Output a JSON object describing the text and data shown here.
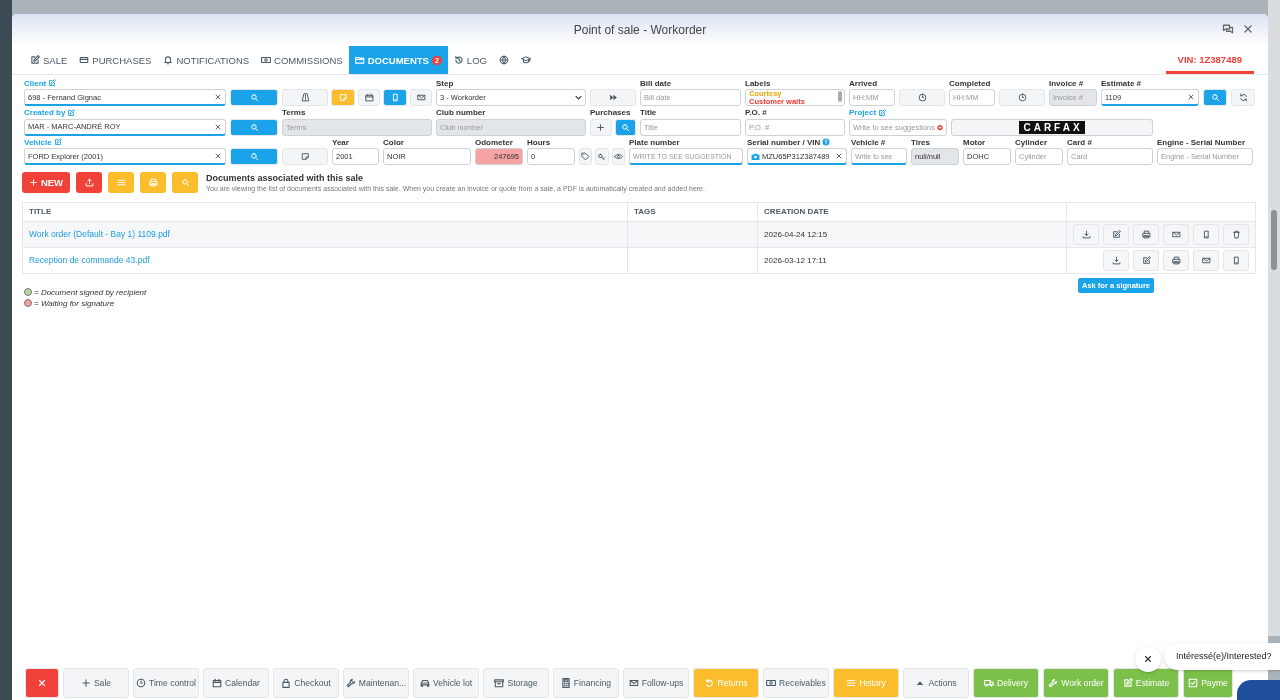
{
  "window": {
    "title": "Point of sale - Workorder"
  },
  "tabs": [
    {
      "label": "SALE",
      "selected": false
    },
    {
      "label": "PURCHASES",
      "selected": false
    },
    {
      "label": "NOTIFICATIONS",
      "selected": false
    },
    {
      "label": "COMMISSIONS",
      "selected": false
    },
    {
      "label": "DOCUMENTS",
      "badge": "2",
      "selected": true
    },
    {
      "label": "LOG",
      "selected": false
    },
    {
      "selected": false
    },
    {
      "selected": false
    }
  ],
  "vin": "VIN: 1Z387489",
  "form_rows": [
    [
      {
        "kind": "field",
        "label": "Client",
        "linked": true,
        "value": "698 - Fernand Gignac",
        "clearable": true
      },
      {
        "kind": "button",
        "color": "#1aa3e8"
      },
      {
        "kind": "buttons",
        "items": [
          {
            "color": "#f3f5f6"
          },
          {
            "color": "#fbbd2c"
          },
          {
            "color": "#f3f5f6"
          },
          {
            "color": "#1aa3e8"
          },
          {
            "color": "#f3f5f6"
          }
        ]
      },
      {
        "kind": "select",
        "label": "Step",
        "linked": false,
        "value": "3 - Workorder"
      },
      {
        "kind": "button",
        "color": "#f3f5f6"
      },
      {
        "kind": "field",
        "label": "Bill date",
        "linked": false,
        "placeholder": "Bill date"
      },
      {
        "kind": "labels",
        "label": "Labels",
        "linked": false,
        "items": [
          {
            "text": "Courtesy",
            "color": "#e6a700"
          },
          {
            "text": "Customer waits",
            "color": "#e53935"
          }
        ]
      },
      {
        "kind": "field",
        "label": "Arrived",
        "linked": false,
        "placeholder": "HH:MM"
      },
      {
        "kind": "button",
        "color": "#f3f5f6"
      },
      {
        "kind": "field",
        "label": "Completed",
        "linked": false,
        "placeholder": "HH:MM"
      },
      {
        "kind": "button",
        "color": "#f3f5f6"
      },
      {
        "kind": "field",
        "label": "Invoice #",
        "linked": false,
        "placeholder": "Invoice #",
        "disabled": true
      },
      {
        "kind": "field",
        "label": "Estimate #",
        "linked": false,
        "value": "1109",
        "clearable": true
      },
      {
        "kind": "button",
        "color": "#1aa3e8"
      },
      {
        "kind": "button",
        "color": "#f3f5f6"
      }
    ],
    [
      {
        "kind": "field",
        "label": "Created by",
        "linked": true,
        "value": "MAR - MARC-ANDRÉ ROY",
        "clearable": true
      },
      {
        "kind": "button",
        "color": "#1aa3e8"
      },
      {
        "kind": "field",
        "label": "Terms",
        "linked": false,
        "placeholder": "Terms",
        "disabled": true
      },
      {
        "kind": "field",
        "label": "Club number",
        "linked": false,
        "placeholder": "Club number",
        "disabled": true
      },
      {
        "kind": "buttons",
        "label": "Purchases",
        "linked": false,
        "items": [
          {
            "color": "#f3f5f6"
          },
          {
            "color": "#1aa3e8"
          }
        ]
      },
      {
        "kind": "field",
        "label": "Title",
        "linked": false,
        "placeholder": "Title"
      },
      {
        "kind": "field",
        "label": "P.O. #",
        "linked": false,
        "placeholder": "P.O. #"
      },
      {
        "kind": "field",
        "label": "Project",
        "linked": true,
        "placeholder": "Write to see suggestions"
      },
      {
        "kind": "logo",
        "text": "CARFAX"
      }
    ],
    [
      {
        "kind": "field",
        "label": "Vehicle",
        "linked": true,
        "value": "FORD Explorer (2001)",
        "clearable": true
      },
      {
        "kind": "button",
        "color": "#1aa3e8"
      },
      {
        "kind": "button",
        "color": "#f3f5f6"
      },
      {
        "kind": "field",
        "label": "Year",
        "linked": false,
        "value": "2001"
      },
      {
        "kind": "field",
        "label": "Color",
        "linked": false,
        "value": "NOIR"
      },
      {
        "kind": "field",
        "label": "Odometer",
        "linked": false,
        "value": "247695",
        "alert": true
      },
      {
        "kind": "field",
        "label": "Hours",
        "linked": false,
        "value": "0"
      },
      {
        "kind": "buttons",
        "items": [
          {
            "color": "#f3f5f6"
          },
          {
            "color": "#f3f5f6"
          },
          {
            "color": "#f3f5f6"
          }
        ]
      },
      {
        "kind": "field",
        "label": "Plate number",
        "linked": false,
        "placeholder": "WRITE TO SEE SUGGESTION"
      },
      {
        "kind": "field",
        "label": "Serial number / VIN",
        "linked": false,
        "value": "MZU65P31Z387489",
        "clearable": true
      },
      {
        "kind": "field",
        "label": "Vehicle #",
        "linked": false,
        "placeholder": "Write to see"
      },
      {
        "kind": "field",
        "label": "Tires",
        "linked": false,
        "value": "null/null",
        "disabled": true
      },
      {
        "kind": "field",
        "label": "Motor",
        "linked": false,
        "value": "DOHC"
      },
      {
        "kind": "field",
        "label": "Cylinder",
        "linked": false,
        "placeholder": "Cylinder"
      },
      {
        "kind": "field",
        "label": "Card #",
        "linked": false,
        "placeholder": "Card"
      },
      {
        "kind": "field",
        "label": "Engine - Serial Number",
        "linked": false,
        "placeholder": "Engine - Serial Number"
      }
    ]
  ],
  "toolbar": {
    "buttons": [
      {
        "label": "NEW",
        "color": "#f0413a"
      },
      {
        "color": "#f0413a"
      },
      {
        "color": "#fbbd2c"
      },
      {
        "color": "#fbbd2c"
      },
      {
        "color": "#fbbd2c"
      }
    ],
    "heading": "Documents associated with this sale",
    "description": "You are viewing the list of documents associated with this sale. When you create an invoice or quote from a sale, a PDF is automatically created and added here."
  },
  "table": {
    "columns": [
      "TITLE",
      "TAGS",
      "CREATION DATE"
    ],
    "rows": [
      {
        "title": "Work order (Default - Bay 1) 1109.pdf",
        "created": "2026-04-24 12:15",
        "deletable": true
      },
      {
        "title": "Reception de commande 43.pdf",
        "created": "2026-03-12 17:11",
        "deletable": false
      }
    ]
  },
  "tooltip": "Ask for a signature",
  "legend": [
    {
      "text": "= Document signed by recipient",
      "color": "#b5d99c"
    },
    {
      "text": "= Waiting for signature",
      "color": "#f4a0a0"
    }
  ],
  "bottom_buttons": [
    {
      "color": "#f0413a"
    },
    {
      "label": "Sale",
      "color": "#f3f5f6"
    },
    {
      "label": "Time control",
      "color": "#f3f5f6"
    },
    {
      "label": "Calendar",
      "color": "#f3f5f6"
    },
    {
      "label": "Checkout",
      "color": "#f3f5f6"
    },
    {
      "label": "Maintenan...",
      "color": "#f3f5f6"
    },
    {
      "label": "Vehicle lot",
      "color": "#f3f5f6"
    },
    {
      "label": "Storage",
      "color": "#f3f5f6"
    },
    {
      "label": "Financing",
      "color": "#f3f5f6"
    },
    {
      "label": "Follow-ups",
      "color": "#f3f5f6"
    },
    {
      "label": "Returns",
      "color": "#fbbd2c"
    },
    {
      "label": "Receivables",
      "color": "#f3f5f6"
    },
    {
      "label": "History",
      "color": "#fbbd2c"
    },
    {
      "label": "Actions",
      "color": "#f3f5f6"
    },
    {
      "label": "Delivery",
      "color": "#7cc04b"
    },
    {
      "label": "Work order",
      "color": "#7cc04b"
    },
    {
      "label": "Estimate",
      "color": "#7cc04b"
    },
    {
      "label": "Payme",
      "color": "#7cc04b"
    }
  ],
  "chat": {
    "prompt": "Intéressé(e)/Interested?"
  }
}
